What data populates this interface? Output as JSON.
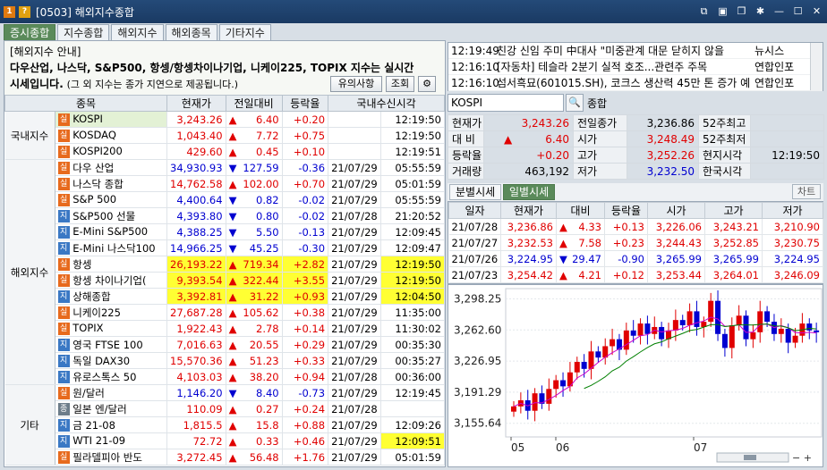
{
  "window": {
    "title": "[0503] 해외지수종합",
    "badge1": "1",
    "badge2": "?"
  },
  "tabs": [
    "증시종합",
    "지수종합",
    "해외지수",
    "해외종목",
    "기타지수"
  ],
  "notice": {
    "title": "[해외지수 안내]",
    "line1": "다우산업, 나스닥, S&P500, 항셍/항셍차이나기업, 니케이225, TOPIX 지수는 실시간",
    "line2_bold": "시세입니다.",
    "line2_small": "(그 외 지수는 종가 지연으로 제공됩니다.)",
    "btn_notice": "유의사항",
    "btn_query": "조회"
  },
  "grid": {
    "headers": [
      "종목",
      "현재가",
      "전일대비",
      "등락율",
      "국내수신시각"
    ],
    "groups": [
      {
        "name": "국내지수",
        "rows": [
          {
            "b": "실",
            "n": "KOSPI",
            "p": "3,243.26",
            "d": "up",
            "c": "6.40",
            "r": "+0.20",
            "dt": "",
            "t": "12:19:50",
            "sel": true
          },
          {
            "b": "실",
            "n": "KOSDAQ",
            "p": "1,043.40",
            "d": "up",
            "c": "7.72",
            "r": "+0.75",
            "dt": "",
            "t": "12:19:50"
          },
          {
            "b": "실",
            "n": "KOSPI200",
            "p": "429.60",
            "d": "up",
            "c": "0.45",
            "r": "+0.10",
            "dt": "",
            "t": "12:19:51"
          }
        ]
      },
      {
        "name": "해외지수",
        "rows": [
          {
            "b": "실",
            "n": "다우 산업",
            "p": "34,930.93",
            "d": "down",
            "c": "127.59",
            "r": "-0.36",
            "dt": "21/07/29",
            "t": "05:55:59"
          },
          {
            "b": "실",
            "n": "나스닥 종합",
            "p": "14,762.58",
            "d": "up",
            "c": "102.00",
            "r": "+0.70",
            "dt": "21/07/29",
            "t": "05:01:59"
          },
          {
            "b": "실",
            "n": "S&P 500",
            "p": "4,400.64",
            "d": "down",
            "c": "0.82",
            "r": "-0.02",
            "dt": "21/07/29",
            "t": "05:55:59"
          },
          {
            "b": "지",
            "n": "S&P500 선물",
            "p": "4,393.80",
            "d": "down",
            "c": "0.80",
            "r": "-0.02",
            "dt": "21/07/28",
            "t": "21:20:52"
          },
          {
            "b": "지",
            "n": "E-Mini S&P500",
            "p": "4,388.25",
            "d": "down",
            "c": "5.50",
            "r": "-0.13",
            "dt": "21/07/29",
            "t": "12:09:45"
          },
          {
            "b": "지",
            "n": "E-Mini 나스닥100",
            "p": "14,966.25",
            "d": "down",
            "c": "45.25",
            "r": "-0.30",
            "dt": "21/07/29",
            "t": "12:09:47"
          },
          {
            "b": "실",
            "n": "항셍",
            "p": "26,193.22",
            "d": "up",
            "c": "719.34",
            "r": "+2.82",
            "dt": "21/07/29",
            "t": "12:19:50",
            "yl": true
          },
          {
            "b": "실",
            "n": "항셍 차이나기업(",
            "p": "9,393.54",
            "d": "up",
            "c": "322.44",
            "r": "+3.55",
            "dt": "21/07/29",
            "t": "12:19:50",
            "yl": true
          },
          {
            "b": "지",
            "n": "상해종합",
            "p": "3,392.81",
            "d": "up",
            "c": "31.22",
            "r": "+0.93",
            "dt": "21/07/29",
            "t": "12:04:50",
            "yl": true
          },
          {
            "b": "실",
            "n": "니케이225",
            "p": "27,687.28",
            "d": "up",
            "c": "105.62",
            "r": "+0.38",
            "dt": "21/07/29",
            "t": "11:35:00"
          },
          {
            "b": "실",
            "n": "TOPIX",
            "p": "1,922.43",
            "d": "up",
            "c": "2.78",
            "r": "+0.14",
            "dt": "21/07/29",
            "t": "11:30:02"
          },
          {
            "b": "지",
            "n": "영국 FTSE 100",
            "p": "7,016.63",
            "d": "up",
            "c": "20.55",
            "r": "+0.29",
            "dt": "21/07/29",
            "t": "00:35:30"
          },
          {
            "b": "지",
            "n": "독일 DAX30",
            "p": "15,570.36",
            "d": "up",
            "c": "51.23",
            "r": "+0.33",
            "dt": "21/07/29",
            "t": "00:35:27"
          },
          {
            "b": "지",
            "n": "유로스톡스 50",
            "p": "4,103.03",
            "d": "up",
            "c": "38.20",
            "r": "+0.94",
            "dt": "21/07/28",
            "t": "00:36:00"
          }
        ]
      },
      {
        "name": "기타",
        "rows": [
          {
            "b": "실",
            "n": "원/달러",
            "p": "1,146.20",
            "d": "down",
            "c": "8.40",
            "r": "-0.73",
            "dt": "21/07/29",
            "t": "12:19:45"
          },
          {
            "b": "종",
            "n": "일본 엔/달러",
            "p": "110.09",
            "d": "up",
            "c": "0.27",
            "r": "+0.24",
            "dt": "21/07/28",
            "t": ""
          },
          {
            "b": "지",
            "n": "금 21-08",
            "p": "1,815.5",
            "d": "up",
            "c": "15.8",
            "r": "+0.88",
            "dt": "21/07/29",
            "t": "12:09:26"
          },
          {
            "b": "지",
            "n": "WTI 21-09",
            "p": "72.72",
            "d": "up",
            "c": "0.33",
            "r": "+0.46",
            "dt": "21/07/29",
            "t": "12:09:51",
            "ylt": true
          },
          {
            "b": "실",
            "n": "필라델피아 반도",
            "p": "3,272.45",
            "d": "up",
            "c": "56.48",
            "r": "+1.76",
            "dt": "21/07/29",
            "t": "05:01:59"
          }
        ]
      }
    ]
  },
  "news": [
    {
      "t": "12:19:49",
      "h": "친강 신임 주미 中대사 \"미중관계 대문 닫히지 않을",
      "s": "뉴시스"
    },
    {
      "t": "12:16:10",
      "h": "[자동차] 테슬라 2분기 실적 호조...관련주 주목",
      "s": "연합인포"
    },
    {
      "t": "12:16:10",
      "h": "섬서흑묘(601015.SH), 코크스 생산력 45만 톤 증가 예",
      "s": "연합인포"
    }
  ],
  "search": {
    "code": "KOSPI",
    "name": "종합"
  },
  "quote": {
    "labels": [
      "현재가",
      "대 비",
      "등락율",
      "거래량",
      "전일종가",
      "시가",
      "고가",
      "저가",
      "52주최고",
      "52주최저",
      "현지시각",
      "한국시각"
    ],
    "price": "3,243.26",
    "chg": "6.40",
    "rate": "+0.20",
    "vol": "463,192",
    "prev": "3,236.86",
    "open": "3,248.49",
    "high": "3,252.26",
    "low": "3,232.50",
    "local_time": "12:19:50"
  },
  "daily_tabs": [
    "분별시세",
    "일별시세"
  ],
  "chart_btn": "차트",
  "daily": {
    "headers": [
      "일자",
      "현재가",
      "대비",
      "등락율",
      "시가",
      "고가",
      "저가"
    ],
    "rows": [
      {
        "dt": "21/07/28",
        "p": "3,236.86",
        "d": "up",
        "c": "4.33",
        "r": "+0.13",
        "o": "3,226.06",
        "h": "3,243.21",
        "l": "3,210.90"
      },
      {
        "dt": "21/07/27",
        "p": "3,232.53",
        "d": "up",
        "c": "7.58",
        "r": "+0.23",
        "o": "3,244.43",
        "h": "3,252.85",
        "l": "3,230.75"
      },
      {
        "dt": "21/07/26",
        "p": "3,224.95",
        "d": "down",
        "c": "29.47",
        "r": "-0.90",
        "o": "3,265.99",
        "h": "3,265.99",
        "l": "3,224.95"
      },
      {
        "dt": "21/07/23",
        "p": "3,254.42",
        "d": "up",
        "c": "4.21",
        "r": "+0.12",
        "o": "3,253.44",
        "h": "3,264.01",
        "l": "3,246.09"
      }
    ]
  },
  "chart_data": {
    "type": "candlestick",
    "y_ticks": [
      "3,298.25",
      "3,262.60",
      "3,226.95",
      "3,191.29",
      "3,155.64"
    ],
    "x_ticks": [
      "05",
      "06",
      "07"
    ],
    "ylim": [
      3140,
      3310
    ],
    "colors": {
      "up": "#e00000",
      "down": "#0000d0",
      "ma1": "#cc00cc",
      "ma2": "#008000"
    }
  }
}
